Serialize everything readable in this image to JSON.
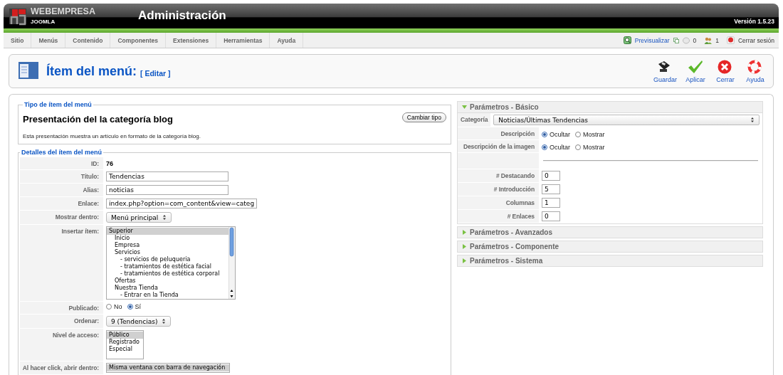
{
  "header": {
    "brand": "WEBEMPRESA",
    "sub": "JOOMLA",
    "title": "Administración",
    "version": "Versión 1.5.23"
  },
  "menu": [
    {
      "label": "Sitio"
    },
    {
      "label": "Menús"
    },
    {
      "label": "Contenido"
    },
    {
      "label": "Componentes"
    },
    {
      "label": "Extensiones"
    },
    {
      "label": "Herramientas"
    },
    {
      "label": "Ayuda"
    }
  ],
  "status": {
    "preview": "Previsualizar",
    "messages": "0",
    "users": "1",
    "logout": "Cerrar sesión"
  },
  "toolbar": {
    "title": "Ítem del menú:",
    "subtitle": "[ Editar ]",
    "buttons": [
      {
        "kind": "save",
        "label": "Guardar"
      },
      {
        "kind": "apply",
        "label": "Aplicar"
      },
      {
        "kind": "close",
        "label": "Cerrar"
      },
      {
        "kind": "help",
        "label": "Ayuda"
      }
    ]
  },
  "type_section": {
    "legend": "Tipo de ítem del menú",
    "button": "Cambiar tipo",
    "heading": "Presentación del la categoría blog",
    "description": "Esta presentación muestra un artículo en formato de la categoría blog."
  },
  "details": {
    "legend": "Detalles del ítem del menú",
    "rows": [
      {
        "kind": "text",
        "label": "ID:",
        "value": "76"
      },
      {
        "kind": "input",
        "label": "Título:",
        "value": "Tendencias"
      },
      {
        "kind": "input",
        "label": "Alias:",
        "value": "noticias"
      },
      {
        "kind": "input",
        "label": "Enlace:",
        "value": "index.php?option=com_content&view=categ"
      },
      {
        "kind": "select",
        "label": "Mostrar dentro:",
        "value": "Menú principal"
      },
      {
        "kind": "tree",
        "label": "Insertar ítem:",
        "options": [
          {
            "label": "Superior",
            "selected": true,
            "children": [
              {
                "label": "Inicio",
                "selected": false
              },
              {
                "label": "Empresa",
                "selected": false
              },
              {
                "label": "Servicios",
                "selected": false,
                "children": [
                  {
                    "label": "- servicios de peluqueria",
                    "selected": false
                  },
                  {
                    "label": "- tratamientos de estética facial",
                    "selected": false
                  },
                  {
                    "label": "- tratamientos de estética corporal",
                    "selected": false
                  }
                ]
              },
              {
                "label": "Ofertas",
                "selected": false
              },
              {
                "label": "Nuestra Tienda",
                "selected": false,
                "children": [
                  {
                    "label": "- Entrar en la Tienda",
                    "selected": false
                  }
                ]
              }
            ]
          }
        ]
      },
      {
        "kind": "radio",
        "label": "Publicado:",
        "options": [
          {
            "label": "No",
            "selected": false
          },
          {
            "label": "Sí",
            "selected": true
          }
        ]
      },
      {
        "kind": "select",
        "label": "Ordenar:",
        "value": "9 (Tendencias)"
      },
      {
        "kind": "list",
        "label": "Nivel de acceso:",
        "options": [
          {
            "label": "Público",
            "selected": true
          },
          {
            "label": "Registrado",
            "selected": false
          },
          {
            "label": "Especial",
            "selected": false
          }
        ]
      },
      {
        "kind": "list",
        "label": "Al hacer click, abrir dentro:",
        "options": [
          {
            "label": "Misma ventana con barra de navegación",
            "selected": true
          }
        ]
      }
    ]
  },
  "params": {
    "panels": [
      {
        "title": "Parámetros - Básico",
        "expanded": true,
        "rows": [
          {
            "kind": "wide-select",
            "label": "Categoría",
            "value": "Noticias/Últimas Tendencias"
          },
          {
            "kind": "radio",
            "label": "Descripción",
            "options": [
              {
                "label": "Ocultar",
                "selected": true
              },
              {
                "label": "Mostrar",
                "selected": false
              }
            ]
          },
          {
            "kind": "radio",
            "label": "Descripción de la imagen",
            "options": [
              {
                "label": "Ocultar",
                "selected": true
              },
              {
                "label": "Mostrar",
                "selected": false
              }
            ]
          },
          {
            "kind": "separator"
          },
          {
            "kind": "input",
            "label": "# Destacando",
            "value": "0"
          },
          {
            "kind": "input",
            "label": "# Introducción",
            "value": "5"
          },
          {
            "kind": "input",
            "label": "Columnas",
            "value": "1"
          },
          {
            "kind": "input",
            "label": "# Enlaces",
            "value": "0"
          }
        ]
      },
      {
        "title": "Parámetros - Avanzados",
        "expanded": false
      },
      {
        "title": "Parámetros - Componente",
        "expanded": false
      },
      {
        "title": "Parámetros - Sistema",
        "expanded": false
      }
    ]
  }
}
